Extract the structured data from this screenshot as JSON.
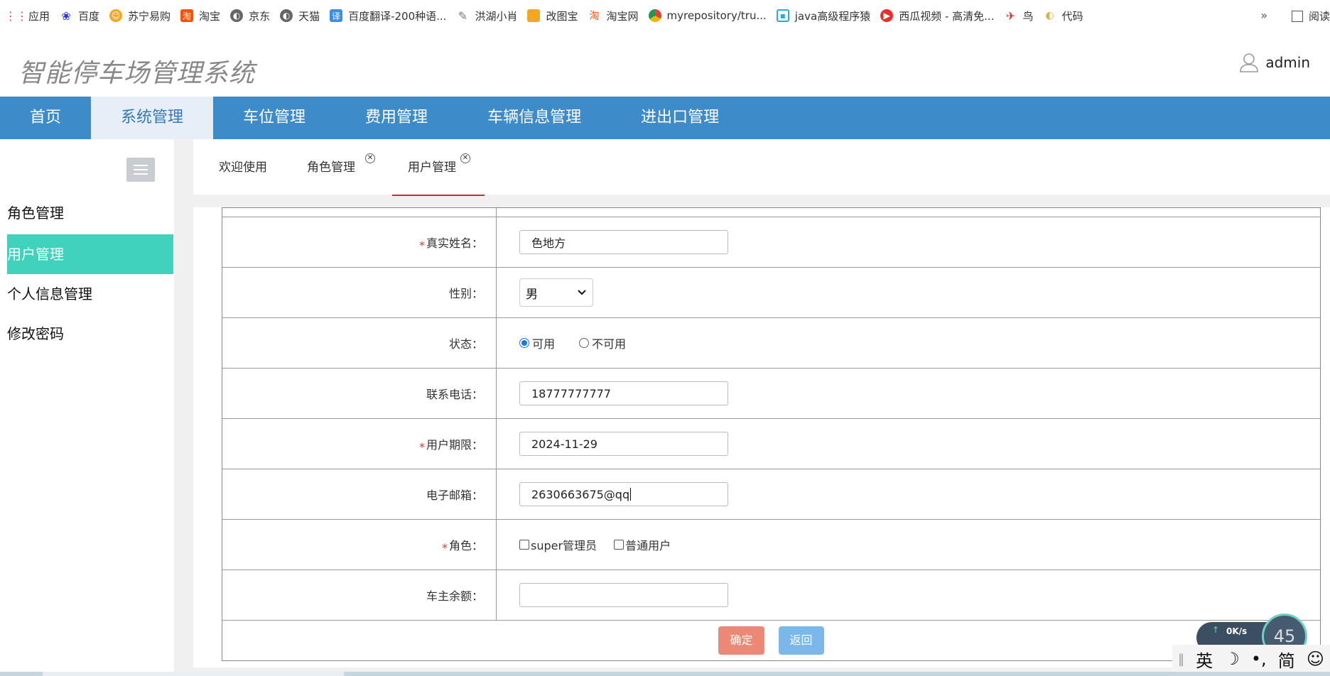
{
  "bookmarks": [
    {
      "label": "应用",
      "icon": "apps-grid-icon",
      "color": "#e94235"
    },
    {
      "label": "百度",
      "icon": "baidu-paw-icon",
      "color": "#2932e1"
    },
    {
      "label": "苏宁易购",
      "icon": "suning-icon",
      "color": "#f5a623"
    },
    {
      "label": "淘宝",
      "icon": "taobao-icon",
      "color": "#ff5000"
    },
    {
      "label": "京东",
      "icon": "globe-icon",
      "color": "#555555"
    },
    {
      "label": "天猫",
      "icon": "globe-icon",
      "color": "#555555"
    },
    {
      "label": "百度翻译-200种语...",
      "icon": "translate-icon",
      "color": "#3a8ee6"
    },
    {
      "label": "洪湖小肖",
      "icon": "bird-icon",
      "color": "#777777"
    },
    {
      "label": "改图宝",
      "icon": "gaitubao-icon",
      "color": "#f5a623"
    },
    {
      "label": "淘宝网",
      "icon": "taobao-icon",
      "color": "#ff5000"
    },
    {
      "label": "myrepository/tru...",
      "icon": "chrome-icon",
      "color": "#4caf50"
    },
    {
      "label": "java高级程序猿",
      "icon": "bilibili-icon",
      "color": "#23ade5"
    },
    {
      "label": "西瓜视频 - 高清免...",
      "icon": "xigua-icon",
      "color": "#e9302d"
    },
    {
      "label": "鸟",
      "icon": "bird-icon",
      "color": "#e9302d"
    },
    {
      "label": "代码",
      "icon": "code-icon",
      "color": "#f5d26b"
    }
  ],
  "bookmarks_more": "»",
  "reading_list": "阅读",
  "app": {
    "title": "智能停车场管理系统",
    "user": "admin"
  },
  "nav": [
    "首页",
    "系统管理",
    "车位管理",
    "费用管理",
    "车辆信息管理",
    "进出口管理"
  ],
  "sidebar": [
    "角色管理",
    "用户管理",
    "个人信息管理",
    "修改密码"
  ],
  "tabs": [
    {
      "label": "欢迎使用",
      "closable": false
    },
    {
      "label": "角色管理",
      "closable": true
    },
    {
      "label": "用户管理",
      "closable": true
    }
  ],
  "form": {
    "real_name": {
      "label": "真实姓名：",
      "value": "色地方"
    },
    "gender": {
      "label": "性别：",
      "value": "男"
    },
    "status": {
      "label": "状态：",
      "options": [
        "可用",
        "不可用"
      ],
      "selected": "可用"
    },
    "phone": {
      "label": "联系电话：",
      "value": "18777777777"
    },
    "expiry": {
      "label": "用户期限：",
      "value": "2024-11-29"
    },
    "email": {
      "label": "电子邮箱：",
      "value": "2630663675@qq"
    },
    "role": {
      "label": "角色：",
      "options": [
        "super管理员",
        "普通用户"
      ]
    },
    "balance": {
      "label": "车主余额：",
      "value": ""
    },
    "confirm": "确定",
    "back": "返回"
  },
  "required_mark": "*",
  "net": {
    "speed": "0K/s",
    "gauge": "45"
  },
  "ime": [
    "英",
    "☽",
    "•,",
    "简",
    "☺"
  ],
  "colors": {
    "nav_bg": "#3e8bca",
    "sidebar_active": "#40d2bd",
    "confirm_btn": "#ec8976",
    "back_btn": "#7cb7e9"
  }
}
